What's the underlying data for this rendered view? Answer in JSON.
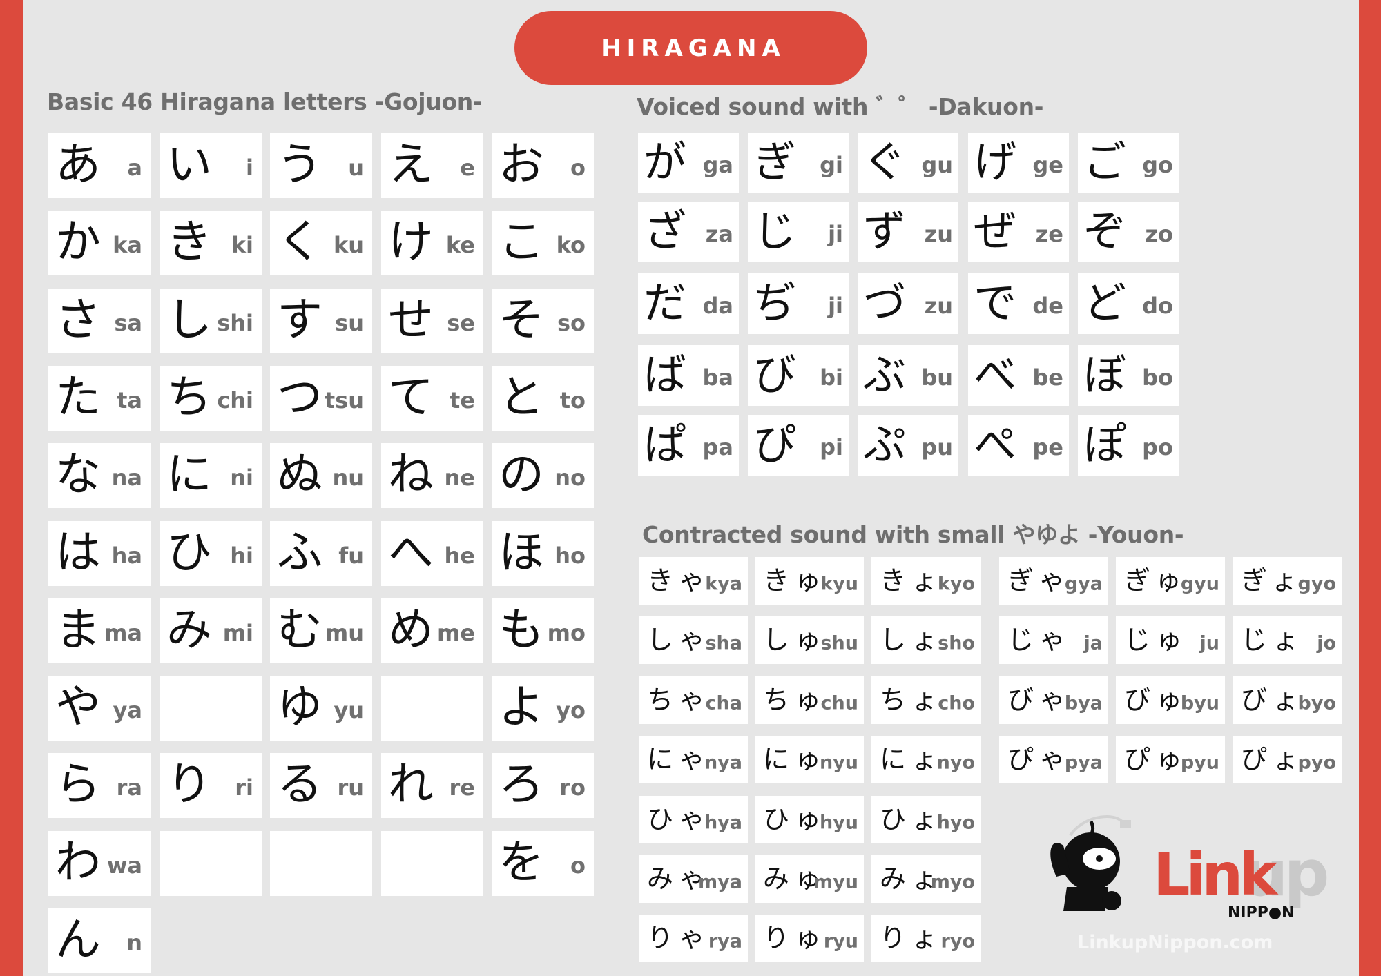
{
  "title": "HIRAGANA",
  "colors": {
    "accent": "#dc4a3d",
    "background": "#e6e6e6",
    "cell": "#ffffff",
    "romaji": "#707070",
    "heading": "#6e6e6e"
  },
  "gojuon": {
    "heading": "Basic 46 Hiragana letters -Gojuon-",
    "rows": [
      [
        {
          "kana": "あ",
          "romaji": "a"
        },
        {
          "kana": "い",
          "romaji": "i"
        },
        {
          "kana": "う",
          "romaji": "u"
        },
        {
          "kana": "え",
          "romaji": "e"
        },
        {
          "kana": "お",
          "romaji": "o"
        }
      ],
      [
        {
          "kana": "か",
          "romaji": "ka"
        },
        {
          "kana": "き",
          "romaji": "ki"
        },
        {
          "kana": "く",
          "romaji": "ku"
        },
        {
          "kana": "け",
          "romaji": "ke"
        },
        {
          "kana": "こ",
          "romaji": "ko"
        }
      ],
      [
        {
          "kana": "さ",
          "romaji": "sa"
        },
        {
          "kana": "し",
          "romaji": "shi"
        },
        {
          "kana": "す",
          "romaji": "su"
        },
        {
          "kana": "せ",
          "romaji": "se"
        },
        {
          "kana": "そ",
          "romaji": "so"
        }
      ],
      [
        {
          "kana": "た",
          "romaji": "ta"
        },
        {
          "kana": "ち",
          "romaji": "chi"
        },
        {
          "kana": "つ",
          "romaji": "tsu"
        },
        {
          "kana": "て",
          "romaji": "te"
        },
        {
          "kana": "と",
          "romaji": "to"
        }
      ],
      [
        {
          "kana": "な",
          "romaji": "na"
        },
        {
          "kana": "に",
          "romaji": "ni"
        },
        {
          "kana": "ぬ",
          "romaji": "nu"
        },
        {
          "kana": "ね",
          "romaji": "ne"
        },
        {
          "kana": "の",
          "romaji": "no"
        }
      ],
      [
        {
          "kana": "は",
          "romaji": "ha"
        },
        {
          "kana": "ひ",
          "romaji": "hi"
        },
        {
          "kana": "ふ",
          "romaji": "fu"
        },
        {
          "kana": "へ",
          "romaji": "he"
        },
        {
          "kana": "ほ",
          "romaji": "ho"
        }
      ],
      [
        {
          "kana": "ま",
          "romaji": "ma"
        },
        {
          "kana": "み",
          "romaji": "mi"
        },
        {
          "kana": "む",
          "romaji": "mu"
        },
        {
          "kana": "め",
          "romaji": "me"
        },
        {
          "kana": "も",
          "romaji": "mo"
        }
      ],
      [
        {
          "kana": "や",
          "romaji": "ya"
        },
        {
          "kana": "",
          "romaji": ""
        },
        {
          "kana": "ゆ",
          "romaji": "yu"
        },
        {
          "kana": "",
          "romaji": ""
        },
        {
          "kana": "よ",
          "romaji": "yo"
        }
      ],
      [
        {
          "kana": "ら",
          "romaji": "ra"
        },
        {
          "kana": "り",
          "romaji": "ri"
        },
        {
          "kana": "る",
          "romaji": "ru"
        },
        {
          "kana": "れ",
          "romaji": "re"
        },
        {
          "kana": "ろ",
          "romaji": "ro"
        }
      ],
      [
        {
          "kana": "わ",
          "romaji": "wa"
        },
        {
          "kana": "",
          "romaji": ""
        },
        {
          "kana": "",
          "romaji": ""
        },
        {
          "kana": "",
          "romaji": ""
        },
        {
          "kana": "を",
          "romaji": "o"
        }
      ],
      [
        {
          "kana": "ん",
          "romaji": "n"
        }
      ]
    ]
  },
  "dakuon": {
    "heading": "Voiced sound with ゛゜ -Dakuon-",
    "rows": [
      [
        {
          "kana": "が",
          "romaji": "ga"
        },
        {
          "kana": "ぎ",
          "romaji": "gi"
        },
        {
          "kana": "ぐ",
          "romaji": "gu"
        },
        {
          "kana": "げ",
          "romaji": "ge"
        },
        {
          "kana": "ご",
          "romaji": "go"
        }
      ],
      [
        {
          "kana": "ざ",
          "romaji": "za"
        },
        {
          "kana": "じ",
          "romaji": "ji"
        },
        {
          "kana": "ず",
          "romaji": "zu"
        },
        {
          "kana": "ぜ",
          "romaji": "ze"
        },
        {
          "kana": "ぞ",
          "romaji": "zo"
        }
      ],
      [
        {
          "kana": "だ",
          "romaji": "da"
        },
        {
          "kana": "ぢ",
          "romaji": "ji"
        },
        {
          "kana": "づ",
          "romaji": "zu"
        },
        {
          "kana": "で",
          "romaji": "de"
        },
        {
          "kana": "ど",
          "romaji": "do"
        }
      ],
      [
        {
          "kana": "ば",
          "romaji": "ba"
        },
        {
          "kana": "び",
          "romaji": "bi"
        },
        {
          "kana": "ぶ",
          "romaji": "bu"
        },
        {
          "kana": "べ",
          "romaji": "be"
        },
        {
          "kana": "ぼ",
          "romaji": "bo"
        }
      ],
      [
        {
          "kana": "ぱ",
          "romaji": "pa"
        },
        {
          "kana": "ぴ",
          "romaji": "pi"
        },
        {
          "kana": "ぷ",
          "romaji": "pu"
        },
        {
          "kana": "ぺ",
          "romaji": "pe"
        },
        {
          "kana": "ぽ",
          "romaji": "po"
        }
      ]
    ]
  },
  "youon": {
    "heading": "Contracted sound with small やゆよ -Youon-",
    "left_rows": [
      [
        {
          "kana": "きゃ",
          "romaji": "kya"
        },
        {
          "kana": "きゅ",
          "romaji": "kyu"
        },
        {
          "kana": "きょ",
          "romaji": "kyo"
        }
      ],
      [
        {
          "kana": "しゃ",
          "romaji": "sha"
        },
        {
          "kana": "しゅ",
          "romaji": "shu"
        },
        {
          "kana": "しょ",
          "romaji": "sho"
        }
      ],
      [
        {
          "kana": "ちゃ",
          "romaji": "cha"
        },
        {
          "kana": "ちゅ",
          "romaji": "chu"
        },
        {
          "kana": "ちょ",
          "romaji": "cho"
        }
      ],
      [
        {
          "kana": "にゃ",
          "romaji": "nya"
        },
        {
          "kana": "にゅ",
          "romaji": "nyu"
        },
        {
          "kana": "にょ",
          "romaji": "nyo"
        }
      ],
      [
        {
          "kana": "ひゃ",
          "romaji": "hya"
        },
        {
          "kana": "ひゅ",
          "romaji": "hyu"
        },
        {
          "kana": "ひょ",
          "romaji": "hyo"
        }
      ],
      [
        {
          "kana": "みゃ",
          "romaji": "mya"
        },
        {
          "kana": "みゅ",
          "romaji": "myu"
        },
        {
          "kana": "みょ",
          "romaji": "myo"
        }
      ],
      [
        {
          "kana": "りゃ",
          "romaji": "rya"
        },
        {
          "kana": "りゅ",
          "romaji": "ryu"
        },
        {
          "kana": "りょ",
          "romaji": "ryo"
        }
      ]
    ],
    "right_rows": [
      [
        {
          "kana": "ぎゃ",
          "romaji": "gya"
        },
        {
          "kana": "ぎゅ",
          "romaji": "gyu"
        },
        {
          "kana": "ぎょ",
          "romaji": "gyo"
        }
      ],
      [
        {
          "kana": "じゃ",
          "romaji": "ja"
        },
        {
          "kana": "じゅ",
          "romaji": "ju"
        },
        {
          "kana": "じょ",
          "romaji": "jo"
        }
      ],
      [
        {
          "kana": "びゃ",
          "romaji": "bya"
        },
        {
          "kana": "びゅ",
          "romaji": "byu"
        },
        {
          "kana": "びょ",
          "romaji": "byo"
        }
      ],
      [
        {
          "kana": "ぴゃ",
          "romaji": "pya"
        },
        {
          "kana": "ぴゅ",
          "romaji": "pyu"
        },
        {
          "kana": "ぴょ",
          "romaji": "pyo"
        }
      ]
    ]
  },
  "logo": {
    "icon": "ninja-mascot-icon",
    "link": "Link",
    "up": "up",
    "nippon": "NIPP●N",
    "site": "LinkupNippon.com"
  }
}
